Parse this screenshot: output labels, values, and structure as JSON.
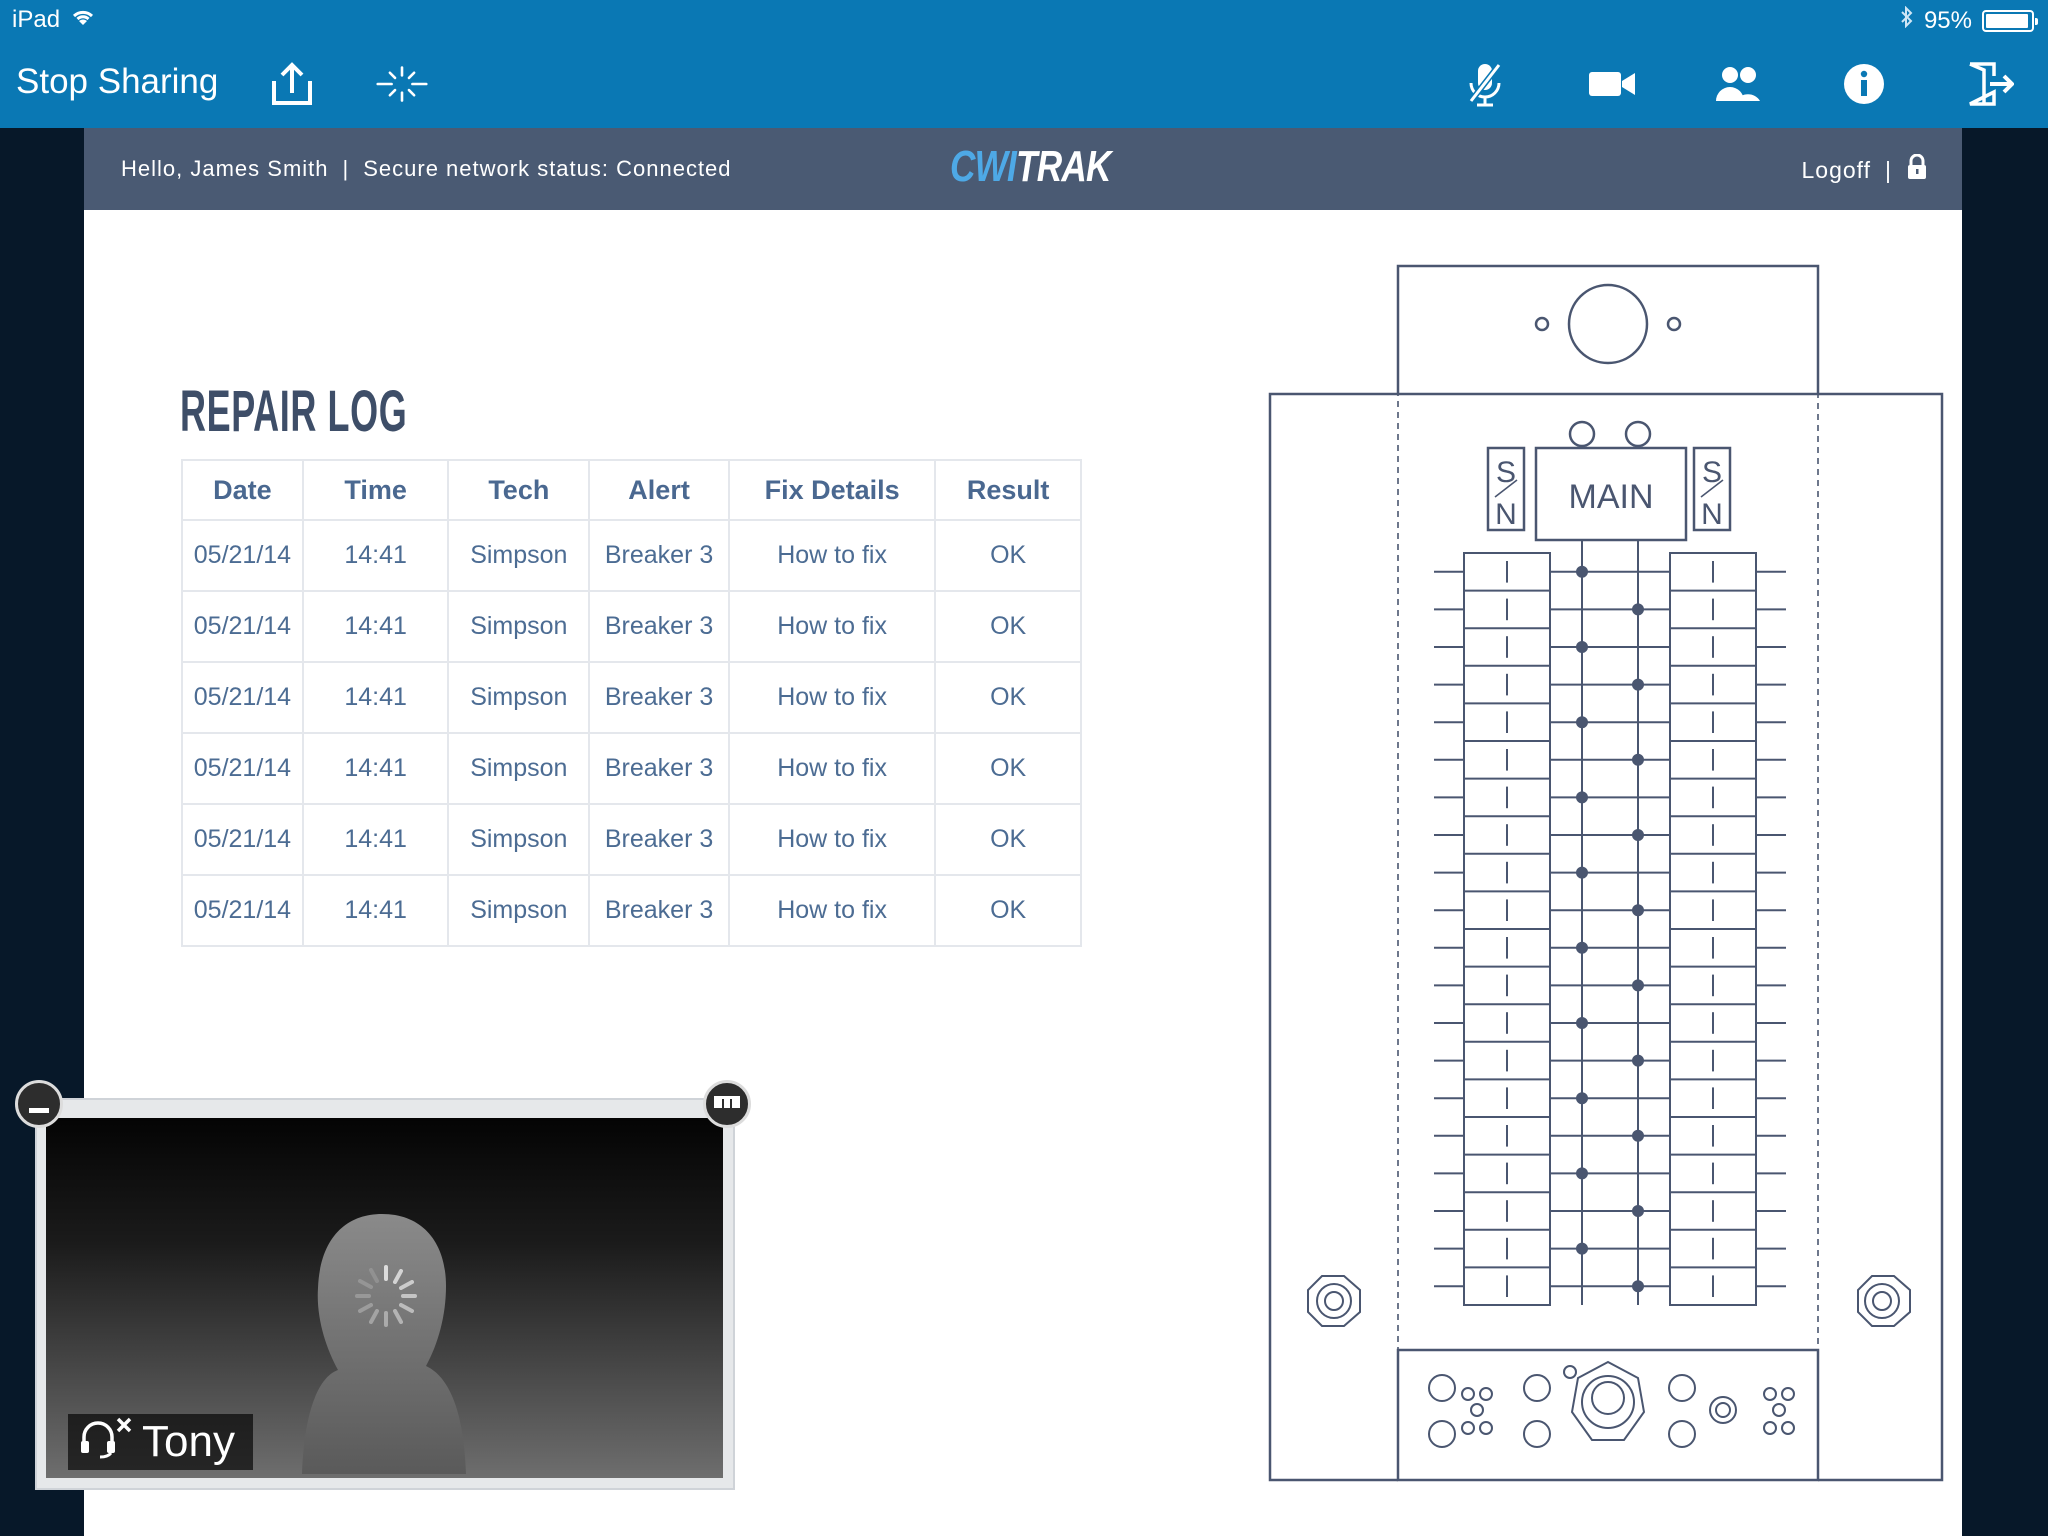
{
  "status_bar": {
    "device": "iPad",
    "battery": "95%",
    "battery_level": 0.95
  },
  "toolbar": {
    "stop_sharing_label": "Stop Sharing",
    "icons": [
      "share-icon",
      "loading-icon",
      "mute-mic-icon",
      "video-camera-icon",
      "participants-icon",
      "info-icon",
      "exit-icon"
    ]
  },
  "app_header": {
    "greeting": "Hello, James Smith",
    "separator": "|",
    "network_status": "Secure network status: Connected",
    "logo_part1": "CWI",
    "logo_part2": "TRAK",
    "logoff_label": "Logoff",
    "logoff_separator": "|"
  },
  "repair_log": {
    "title": "REPAIR LOG",
    "columns": [
      "Date",
      "Time",
      "Tech",
      "Alert",
      "Fix Details",
      "Result"
    ],
    "rows": [
      [
        "05/21/14",
        "14:41",
        "Simpson",
        "Breaker 3",
        "How to fix",
        "OK"
      ],
      [
        "05/21/14",
        "14:41",
        "Simpson",
        "Breaker 3",
        "How to fix",
        "OK"
      ],
      [
        "05/21/14",
        "14:41",
        "Simpson",
        "Breaker 3",
        "How to fix",
        "OK"
      ],
      [
        "05/21/14",
        "14:41",
        "Simpson",
        "Breaker 3",
        "How to fix",
        "OK"
      ],
      [
        "05/21/14",
        "14:41",
        "Simpson",
        "Breaker 3",
        "How to fix",
        "OK"
      ],
      [
        "05/21/14",
        "14:41",
        "Simpson",
        "Breaker 3",
        "How to fix",
        "OK"
      ]
    ]
  },
  "panel_diagram": {
    "main_label": "MAIN",
    "sn_left_top": "S",
    "sn_left_bottom": "N",
    "sn_right_top": "S",
    "sn_right_bottom": "N",
    "breaker_rows": 20
  },
  "video": {
    "participant_name": "Tony"
  },
  "colors": {
    "toolbar": "#0a78b4",
    "app_header": "#4a5a73",
    "table_text": "#4c6c93",
    "diagram_stroke": "#4a5670"
  }
}
